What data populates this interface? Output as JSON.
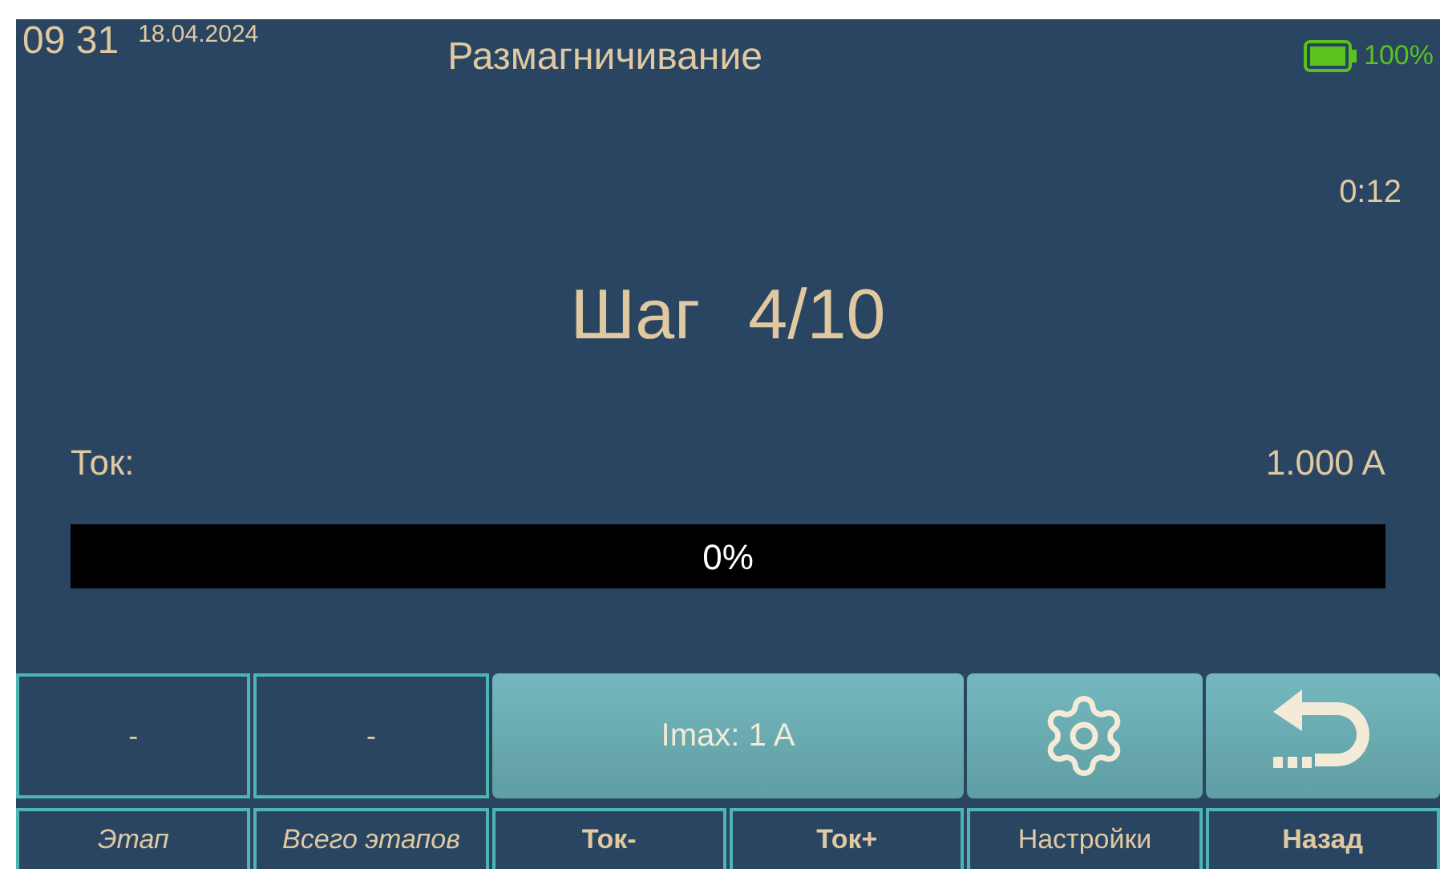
{
  "status_bar": {
    "time": "09 31",
    "date": "18.04.2024",
    "title": "Размагничивание",
    "battery": "100%"
  },
  "timer": "0:12",
  "step": {
    "label": "Шаг",
    "value": "4/10"
  },
  "current": {
    "label": "Ток:",
    "value": "1.000 A"
  },
  "progress": {
    "level": 0,
    "reading": "0%"
  },
  "cells": [
    {
      "kind": "value",
      "text": "-"
    },
    {
      "kind": "value",
      "text": "-"
    },
    {
      "kind": "button",
      "text": "Imax: 1 A"
    },
    {
      "kind": "settings"
    },
    {
      "kind": "back"
    }
  ],
  "labels": [
    {
      "text": "Этап",
      "kind": "italic"
    },
    {
      "text": "Всего этапов",
      "kind": "italic"
    },
    {
      "text": "Ток-",
      "kind": "bold"
    },
    {
      "text": "Ток+",
      "kind": "bold"
    },
    {
      "text": "Настройки",
      "kind": "plain"
    },
    {
      "text": "Назад",
      "kind": "bold"
    }
  ]
}
